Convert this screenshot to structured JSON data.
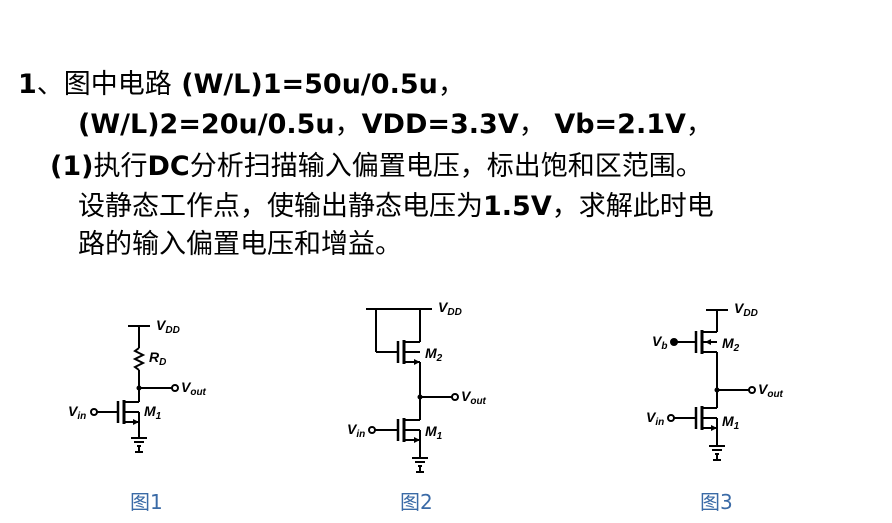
{
  "problem": {
    "line1_number": "1",
    "line1_sep": "、",
    "line1_cn": "图中电路",
    "line1_math": " (W/L)1=50u/0.5u",
    "line1_end": "，",
    "line2_math": "(W/L)2=20u/0.5u",
    "line2_sep1": "，",
    "line2_math2": "VDD=3.3V",
    "line2_sep2": "， ",
    "line2_math3": "Vb=2.1V",
    "line2_end": "，",
    "line3_index": "(1)",
    "line3_cn1": "执行",
    "line3_bold": "DC",
    "line3_cn2": "分析扫描输入偏置电压，标出饱和区范围。",
    "line4_cn1": "设静态工作点，使输出静态电压为",
    "line4_bold": "1.5V",
    "line4_cn2": "，求解此时电",
    "line5_cn": "路的输入偏置电压和增益。"
  },
  "figures": {
    "fig1": {
      "vdd_main": "V",
      "vdd_sub": "DD",
      "rd_main": "R",
      "rd_sub": "D",
      "vout_main": "V",
      "vout_sub": "out",
      "vin_main": "V",
      "vin_sub": "in",
      "m1_main": "M",
      "m1_sub": "1",
      "caption": "图1"
    },
    "fig2": {
      "vdd_main": "V",
      "vdd_sub": "DD",
      "m2_main": "M",
      "m2_sub": "2",
      "vout_main": "V",
      "vout_sub": "out",
      "vin_main": "V",
      "vin_sub": "in",
      "m1_main": "M",
      "m1_sub": "1",
      "caption": "图2"
    },
    "fig3": {
      "vdd_main": "V",
      "vdd_sub": "DD",
      "vb_main": "V",
      "vb_sub": "b",
      "m2_main": "M",
      "m2_sub": "2",
      "vout_main": "V",
      "vout_sub": "out",
      "vin_main": "V",
      "vin_sub": "in",
      "m1_main": "M",
      "m1_sub": "1",
      "caption": "图3"
    }
  }
}
